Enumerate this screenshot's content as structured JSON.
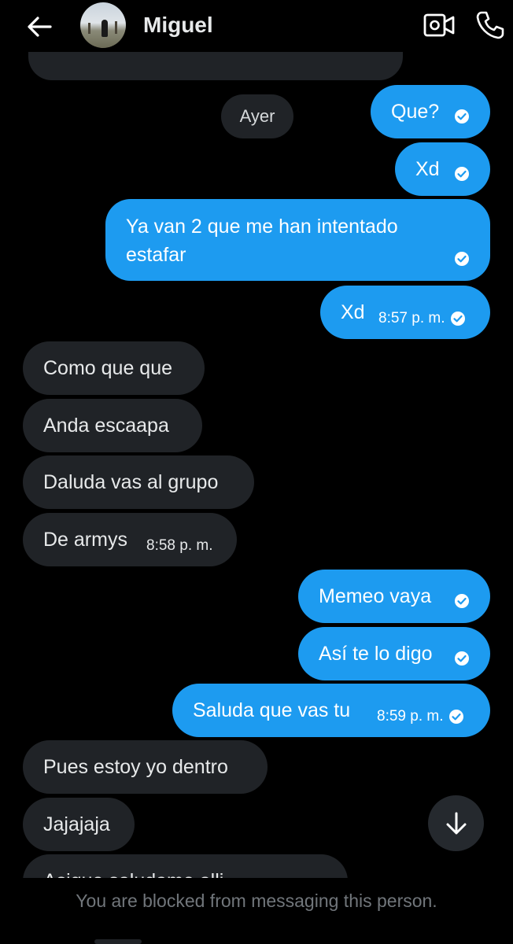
{
  "header": {
    "contact_name": "Miguel",
    "back_icon": "arrow-left-icon",
    "video_icon": "video-camera-icon",
    "phone_icon": "phone-icon"
  },
  "day_separator": "Ayer",
  "messages": [
    {
      "dir": "out",
      "text": "Que?"
    },
    {
      "dir": "out",
      "text": "Xd"
    },
    {
      "dir": "out",
      "text": "Ya van 2 que me han intentado estafar"
    },
    {
      "dir": "out",
      "text": "Xd",
      "time": "8:57 p. m."
    },
    {
      "dir": "in",
      "text": "Como que que"
    },
    {
      "dir": "in",
      "text": "Anda escaapa"
    },
    {
      "dir": "in",
      "text": "Daluda vas al grupo"
    },
    {
      "dir": "in",
      "text": "De armys",
      "time": "8:58 p. m."
    },
    {
      "dir": "out",
      "text": "Memeo vaya"
    },
    {
      "dir": "out",
      "text": "Así te lo digo"
    },
    {
      "dir": "out",
      "text": "Saluda que vas tu",
      "time": "8:59 p. m."
    },
    {
      "dir": "in",
      "text": "Pues estoy yo dentro"
    },
    {
      "dir": "in",
      "text": "Jajajaja"
    },
    {
      "dir": "in",
      "text": "Asique saludame alli"
    }
  ],
  "scroll_button_icon": "arrow-down-icon",
  "footer": {
    "blocked_notice": "You are blocked from messaging this person."
  },
  "colors": {
    "background": "#000000",
    "outgoing_bubble": "#1d9bf0",
    "incoming_bubble": "#202327",
    "muted_text": "#71767b"
  }
}
